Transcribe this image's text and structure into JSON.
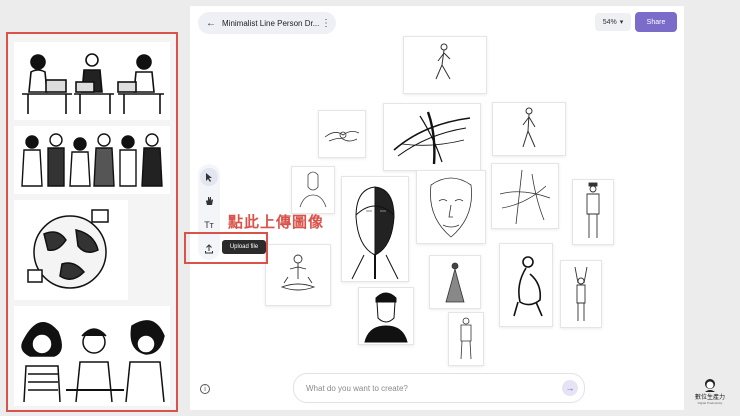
{
  "header": {
    "title": "Minimalist Line Person Dr...",
    "zoom": "54%",
    "share_label": "Share"
  },
  "toolbar": {
    "tools": [
      {
        "name": "select",
        "icon": "cursor-icon"
      },
      {
        "name": "hand",
        "icon": "hand-icon"
      },
      {
        "name": "text",
        "icon": "text-icon",
        "glyph": "Tт"
      },
      {
        "name": "upload",
        "icon": "upload-icon"
      }
    ],
    "tooltip": "Upload file"
  },
  "annotation": "點此上傳圖像",
  "prompt": {
    "placeholder": "What do you want to create?"
  },
  "brand": {
    "name": "數位生產力",
    "tagline": "Digital Productivity"
  },
  "colors": {
    "accent": "#7b6cc9",
    "highlight": "#d9534a"
  }
}
